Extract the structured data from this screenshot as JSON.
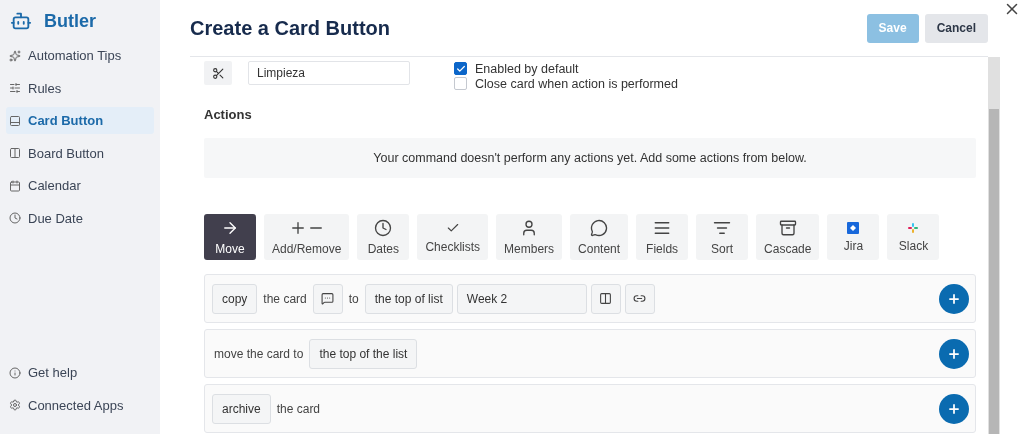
{
  "sidebar": {
    "title": "Butler",
    "items": [
      {
        "label": "Automation Tips",
        "selected": false
      },
      {
        "label": "Rules",
        "selected": false
      },
      {
        "label": "Card Button",
        "selected": true
      },
      {
        "label": "Board Button",
        "selected": false
      },
      {
        "label": "Calendar",
        "selected": false
      },
      {
        "label": "Due Date",
        "selected": false
      }
    ],
    "footer_items": [
      {
        "label": "Get help"
      },
      {
        "label": "Connected Apps"
      }
    ]
  },
  "header": {
    "title": "Create a Card Button",
    "buttons": [
      {
        "label": "Save",
        "kind": "primary",
        "disabled": true
      },
      {
        "label": "Cancel",
        "kind": "secondary"
      }
    ]
  },
  "name_field": {
    "value": "Limpieza"
  },
  "options": [
    {
      "label": "Enabled by default",
      "checked": true
    },
    {
      "label": "Close card when action is performed",
      "checked": false
    }
  ],
  "actions": {
    "heading": "Actions",
    "empty_message": "Your command doesn't perform any actions yet. Add some actions from below."
  },
  "action_tabs": [
    {
      "label": "Move",
      "selected": true
    },
    {
      "label": "Add/Remove",
      "selected": false
    },
    {
      "label": "Dates",
      "selected": false
    },
    {
      "label": "Checklists",
      "selected": false
    },
    {
      "label": "Members",
      "selected": false
    },
    {
      "label": "Content",
      "selected": false
    },
    {
      "label": "Fields",
      "selected": false
    },
    {
      "label": "Sort",
      "selected": false
    },
    {
      "label": "Cascade",
      "selected": false
    },
    {
      "label": "Jira",
      "selected": false
    },
    {
      "label": "Slack",
      "selected": false
    }
  ],
  "action_rows": [
    {
      "parts": [
        {
          "kind": "select",
          "text": "copy"
        },
        {
          "kind": "text",
          "text": "the card"
        },
        {
          "kind": "comment"
        },
        {
          "kind": "text",
          "text": "to"
        },
        {
          "kind": "select",
          "text": "the top of list"
        },
        {
          "kind": "input",
          "text": "Week 2"
        },
        {
          "kind": "columns"
        },
        {
          "kind": "link"
        }
      ]
    },
    {
      "parts": [
        {
          "kind": "text",
          "text": "move the card to"
        },
        {
          "kind": "select",
          "text": "the top of the list"
        }
      ]
    },
    {
      "parts": [
        {
          "kind": "select",
          "text": "archive"
        },
        {
          "kind": "text",
          "text": "the card"
        }
      ]
    }
  ]
}
